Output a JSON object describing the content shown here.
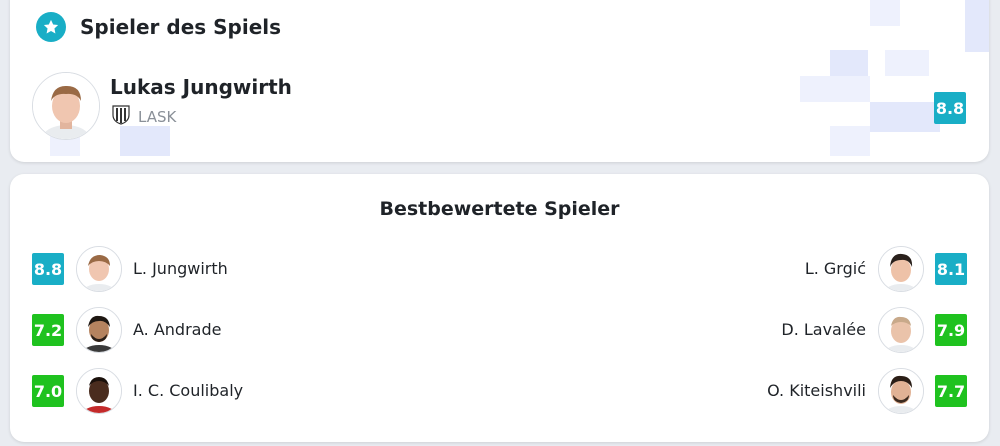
{
  "motm": {
    "title": "Spieler des Spiels",
    "player_name": "Lukas Jungwirth",
    "club": "LASK",
    "rating": "8.8",
    "rating_color": "#19aec6"
  },
  "best_rated": {
    "title": "Bestbewertete Spieler",
    "home": [
      {
        "name": "L. Jungwirth",
        "rating": "8.8",
        "color": "blue"
      },
      {
        "name": "A. Andrade",
        "rating": "7.2",
        "color": "green"
      },
      {
        "name": "I. C. Coulibaly",
        "rating": "7.0",
        "color": "green"
      }
    ],
    "away": [
      {
        "name": "L. Grgić",
        "rating": "8.1",
        "color": "blue"
      },
      {
        "name": "D. Lavalée",
        "rating": "7.9",
        "color": "green"
      },
      {
        "name": "O. Kiteishvili",
        "rating": "7.7",
        "color": "green"
      }
    ]
  },
  "colors": {
    "accent_blue": "#19aec6",
    "rating_green": "#1fc21f"
  },
  "icons": [
    "star-icon",
    "lask-club-icon"
  ]
}
